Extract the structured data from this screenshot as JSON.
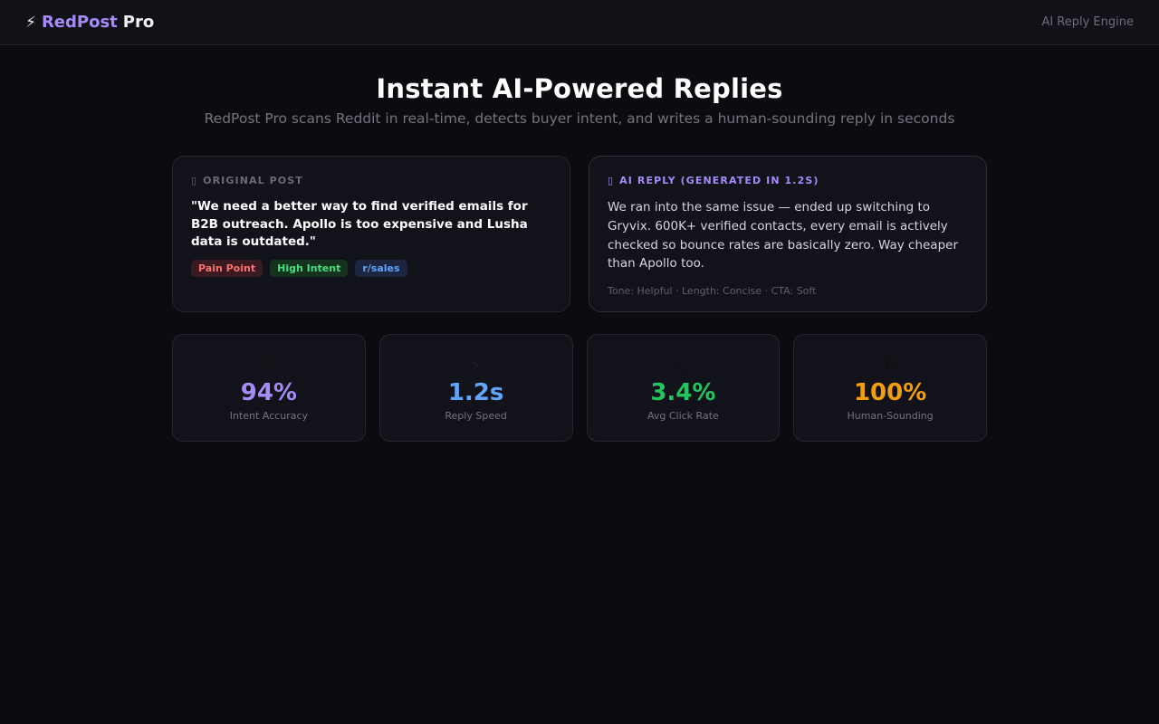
{
  "header": {
    "bolt_icon": "⚡",
    "brand_red": "RedPost",
    "brand_pro": "Pro",
    "right_text": "AI Reply Engine"
  },
  "hero": {
    "title": "Instant AI-Powered Replies",
    "subtitle": "RedPost Pro scans Reddit in real-time, detects buyer intent, and writes a human-sounding reply in seconds"
  },
  "original_post": {
    "icon": "document-icon",
    "label": "ORIGINAL POST",
    "text": "\"We need a better way to find verified emails for B2B outreach. Apollo is too expensive and Lusha data is outdated.\"",
    "tags": [
      {
        "label": "Pain Point",
        "color": "#f87171"
      },
      {
        "label": "High Intent",
        "color": "#4ade80"
      },
      {
        "label": "r/sales",
        "color": "#60a5fa"
      }
    ]
  },
  "ai_reply": {
    "icon": "robot-icon",
    "label": "AI REPLY (GENERATED IN 1.2S)",
    "text": "We ran into the same issue — ended up switching to Gryvix. 600K+ verified contacts, every email is actively checked so bounce rates are basically zero. Way cheaper than Apollo too.",
    "meta": "Tone: Helpful · Length: Concise · CTA: Soft"
  },
  "stats": [
    {
      "icon": "target-icon",
      "glyph": "▯",
      "value": "94%",
      "label": "Intent Accuracy",
      "color": "#a78bfa"
    },
    {
      "icon": "lightning-icon",
      "glyph": "⚡",
      "value": "1.2s",
      "label": "Reply Speed",
      "color": "#60a5fa"
    },
    {
      "icon": "chart-icon",
      "glyph": "▯",
      "value": "3.4%",
      "label": "Avg Click Rate",
      "color": "#22c55e"
    },
    {
      "icon": "person-icon",
      "glyph": "▯",
      "value": "100%",
      "label": "Human-Sounding",
      "color": "#f59e0b"
    }
  ]
}
